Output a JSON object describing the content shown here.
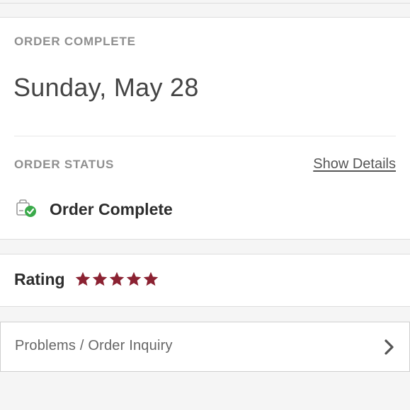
{
  "order": {
    "eyebrow": "ORDER COMPLETE",
    "date": "Sunday, May 28",
    "status_eyebrow": "ORDER STATUS",
    "show_details_label": "Show Details",
    "status_text": "Order Complete",
    "status_icon": "bag-check-icon"
  },
  "rating": {
    "label": "Rating",
    "stars": 5,
    "max_stars": 5,
    "star_color": "#8b2232"
  },
  "inquiry": {
    "label": "Problems / Order Inquiry",
    "icon": "chevron-right-icon"
  },
  "colors": {
    "background": "#f5f5f5",
    "card": "#ffffff",
    "success": "#3aaa4a",
    "accent": "#8b2232"
  }
}
